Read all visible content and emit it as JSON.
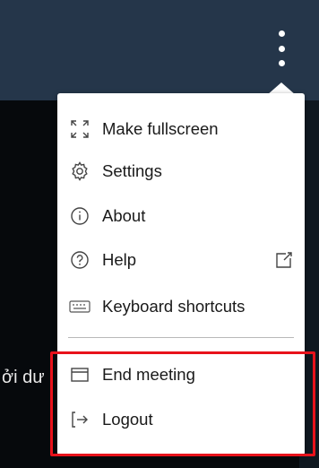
{
  "background": {
    "partial_text": "ởi dư"
  },
  "menu": {
    "items": [
      {
        "label": "Make fullscreen",
        "icon": "fullscreen-icon"
      },
      {
        "label": "Settings",
        "icon": "gear-icon"
      },
      {
        "label": "About",
        "icon": "info-icon"
      },
      {
        "label": "Help",
        "icon": "help-icon",
        "external": "external-link-icon"
      },
      {
        "label": "Keyboard shortcuts",
        "icon": "keyboard-icon"
      },
      {
        "label": "End meeting",
        "icon": "window-icon"
      },
      {
        "label": "Logout",
        "icon": "logout-icon"
      }
    ]
  },
  "colors": {
    "topbar": "#25364a",
    "content": "#06090c",
    "menu_bg": "#ffffff",
    "highlight": "#e8121b"
  }
}
